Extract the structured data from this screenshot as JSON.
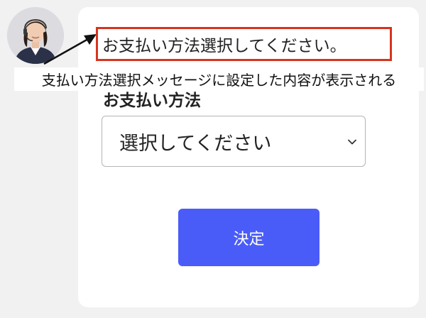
{
  "annotation": {
    "message_text": "お支払い方法選択してください。",
    "caption_text": "支払い方法選択メッセージに設定した内容が表示される",
    "highlight_color": "#d7341f"
  },
  "form": {
    "payment_label": "お支払い方法",
    "payment_select_value": "選択してください",
    "submit_label": "決定",
    "submit_color": "#4a5cf8"
  }
}
